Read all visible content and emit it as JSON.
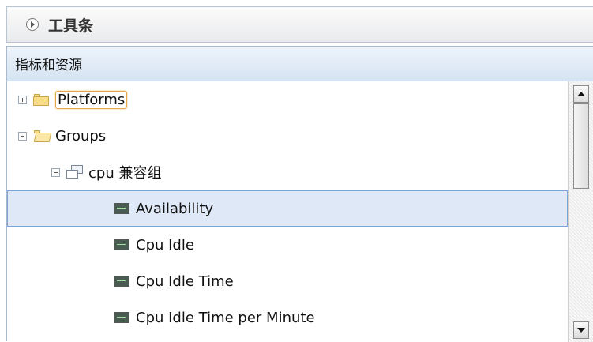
{
  "toolbar": {
    "title": "工具条"
  },
  "panel": {
    "title": "指标和资源",
    "tree": {
      "platforms_label": "Platforms",
      "groups_label": "Groups",
      "group_name": "cpu 兼容组",
      "metrics": [
        "Availability",
        "Cpu Idle",
        "Cpu Idle Time",
        "Cpu Idle Time per Minute"
      ],
      "selected": "Availability"
    }
  },
  "colors": {
    "selection_bg": "#dfe8f6",
    "selection_border": "#7fa5d3",
    "focus_border": "#e3a64b",
    "header_gradient": "#d5e3f2"
  }
}
